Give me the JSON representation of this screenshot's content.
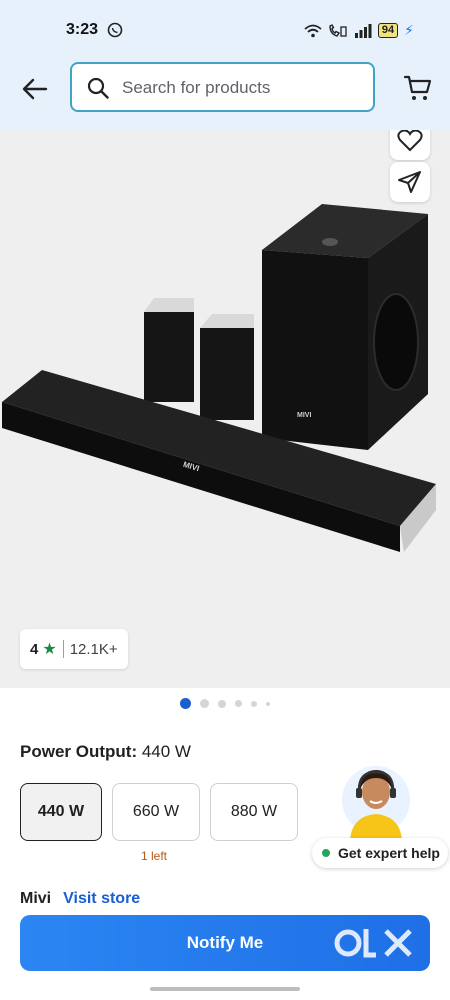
{
  "status_bar": {
    "time": "3:23",
    "battery": "94",
    "icons": [
      "whatsapp-icon",
      "wifi-icon",
      "volte-call-icon",
      "signal-icon",
      "battery-icon",
      "charging-icon"
    ]
  },
  "header": {
    "search_placeholder": "Search for products",
    "icons": [
      "back-arrow-icon",
      "search-icon",
      "cart-icon"
    ]
  },
  "product": {
    "brand_on_product": "MIVI",
    "rating": {
      "value": "4",
      "count": "12.1K+"
    },
    "image_actions": [
      "wishlist-icon",
      "share-icon"
    ],
    "carousel": {
      "total": 6,
      "active_index": 0
    }
  },
  "variant_selector": {
    "label": "Power Output:",
    "selected_value": "440 W",
    "options": [
      {
        "label": "440 W",
        "selected": true
      },
      {
        "label": "660 W",
        "selected": false
      },
      {
        "label": "880 W",
        "selected": false
      }
    ],
    "stock_note": "1 left"
  },
  "expert_help": {
    "label": "Get expert help"
  },
  "seller": {
    "brand": "Mivi",
    "link": "Visit store"
  },
  "cta": {
    "label": "Notify Me"
  },
  "watermark": {
    "logo_text": "olx"
  },
  "colors": {
    "header_bg": "#e6f1fb",
    "search_border": "#41a3c6",
    "cta_blue": "#2b86f3",
    "link_blue": "#1a5fd1",
    "star_green": "#1b8a45",
    "stock_orange": "#b35a1a"
  }
}
